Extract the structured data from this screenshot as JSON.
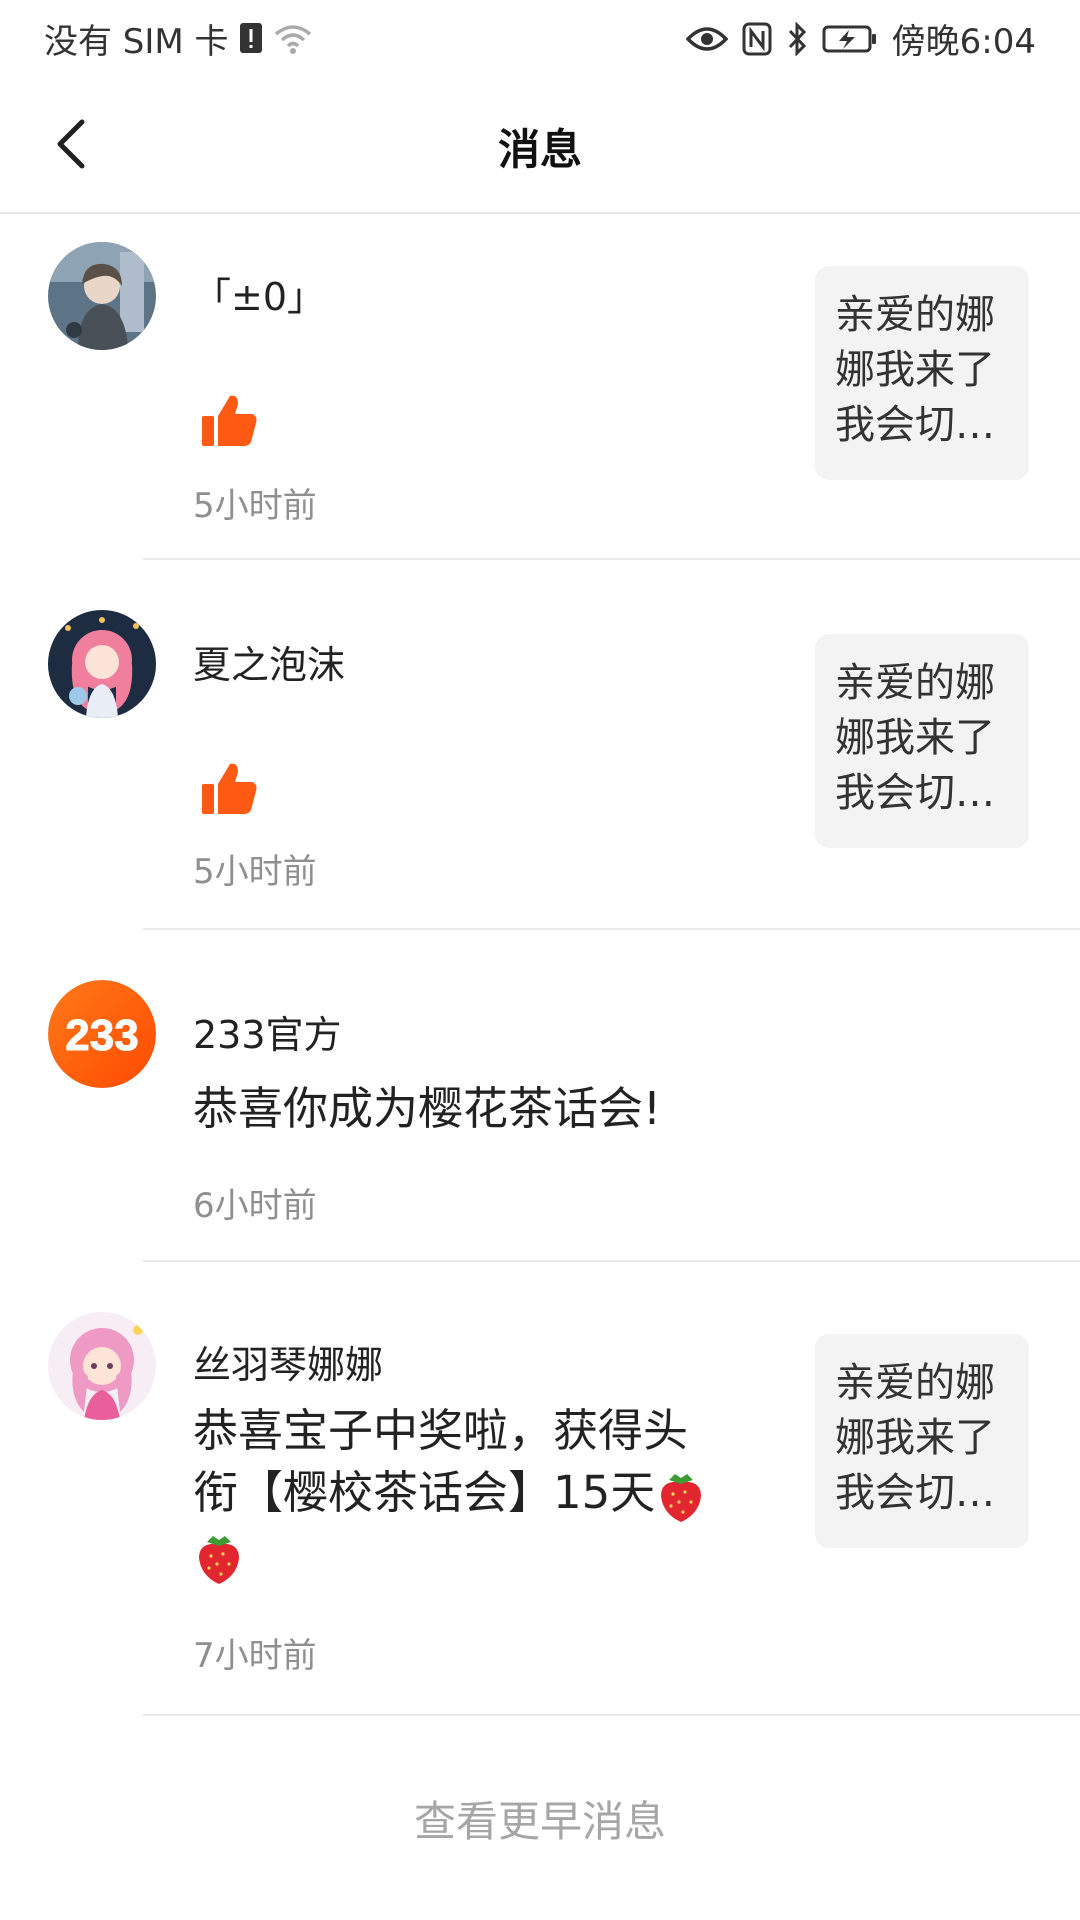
{
  "status_bar": {
    "carrier": "没有 SIM 卡",
    "time": "傍晚6:04",
    "icons": [
      "sim-alert-icon",
      "wifi-icon",
      "eye-icon",
      "nfc-icon",
      "bluetooth-icon",
      "battery-icon"
    ]
  },
  "header": {
    "title": "消息",
    "back_icon": "chevron-left-icon"
  },
  "messages": [
    {
      "sender": "「±0」",
      "type": "like",
      "icon": "thumbs-up-icon",
      "time": "5小时前",
      "quote_lines": [
        "亲爱的娜",
        "娜我来了",
        "我会切…"
      ]
    },
    {
      "sender": "夏之泡沫",
      "type": "like",
      "icon": "thumbs-up-icon",
      "time": "5小时前",
      "quote_lines": [
        "亲爱的娜",
        "娜我来了",
        "我会切…"
      ]
    },
    {
      "sender": "233官方",
      "avatar_text": "233",
      "type": "text",
      "text": "恭喜你成为樱花茶话会!",
      "time": "6小时前"
    },
    {
      "sender": "丝羽琴娜娜",
      "type": "text",
      "text_line1": "恭喜宝子中奖啦，获得头",
      "text_line2": "衔【樱校茶话会】15天",
      "emoji": "strawberry-emoji",
      "time": "7小时前",
      "quote_lines": [
        "亲爱的娜",
        "娜我来了",
        "我会切…"
      ]
    }
  ],
  "footer": {
    "more_label": "查看更早消息"
  },
  "colors": {
    "accent": "#ff5a14",
    "time_text": "#8f8f8f",
    "quote_bg": "#f3f3f3",
    "divider": "#e9e9e9"
  }
}
